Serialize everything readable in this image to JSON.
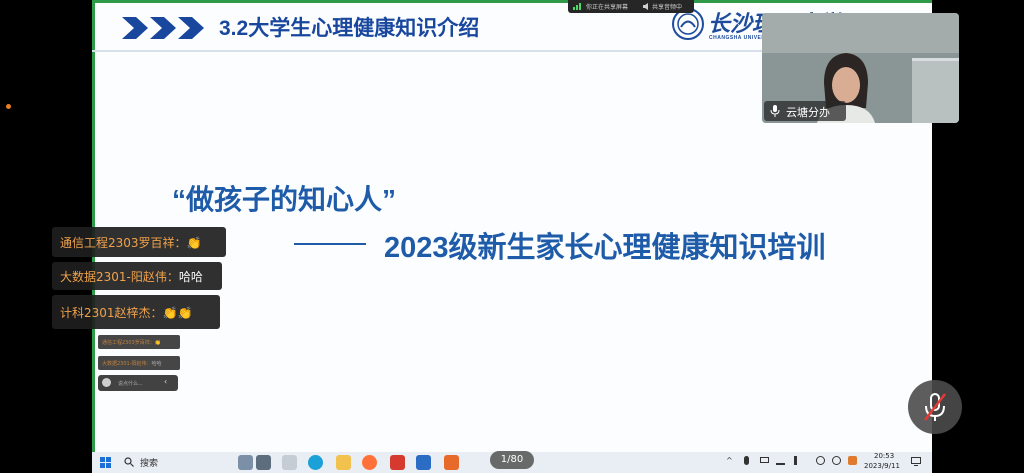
{
  "slide": {
    "title": "3.2大学生心理健康知识介绍",
    "logo_text": "长沙理工大学",
    "logo_sub": "CHANGSHA UNIVERSITY",
    "quote": "“做孩子的知心人”",
    "subtitle": "2023级新生家长心理健康知识培训"
  },
  "share_bar": {
    "sharing_label": "你正在共享屏幕",
    "audio_label": "共享音频中"
  },
  "video": {
    "participant_name": "云塘分办"
  },
  "chat": {
    "messages": [
      {
        "sender": "通信工程2303罗百祥：",
        "text": "👏"
      },
      {
        "sender": "大数据2301-阳赵伟：",
        "text": "哈哈"
      },
      {
        "sender": "计科2301赵梓杰：",
        "text": "👏👏"
      }
    ],
    "mini_messages": [
      {
        "sender": "通信工程2303罗百祥：",
        "text": "👏"
      },
      {
        "sender": "大数据2301-阳赵伟：",
        "text": "哈哈"
      }
    ],
    "input_placeholder": "说点什么..."
  },
  "presentation": {
    "page_indicator": "1/80"
  },
  "taskbar": {
    "search_label": "搜索",
    "time": "20:53",
    "date": "2023/9/11"
  },
  "colors": {
    "title_blue": "#19479e",
    "body_blue": "#1e5ba8",
    "accent_green": "#2f9a48",
    "chat_sender": "#f0a24b"
  }
}
